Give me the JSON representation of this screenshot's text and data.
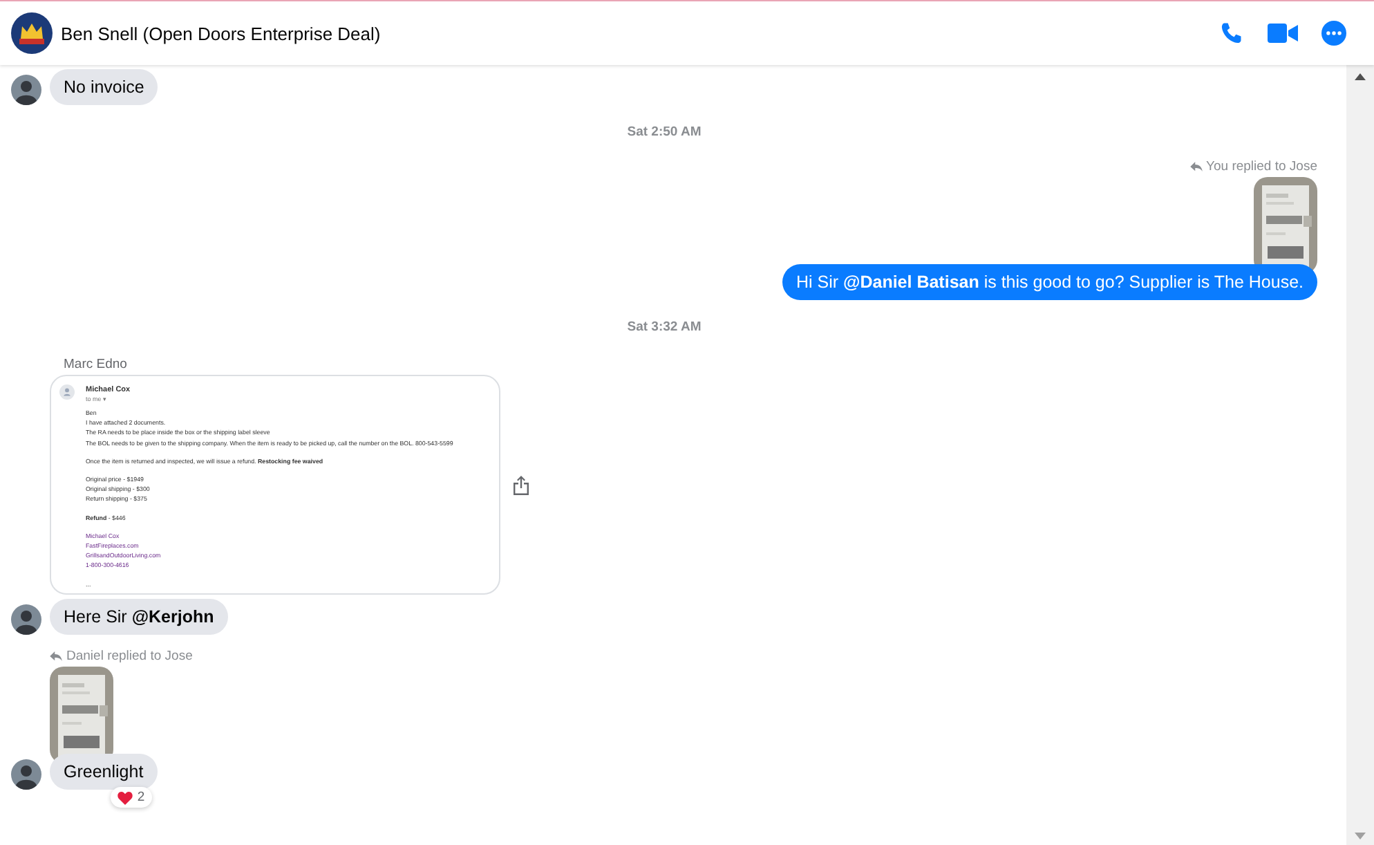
{
  "header": {
    "title": "Ben Snell (Open Doors Enterprise Deal)",
    "actions": [
      {
        "kind": "call"
      },
      {
        "kind": "video"
      },
      {
        "kind": "more"
      }
    ]
  },
  "messages": [
    {
      "kind": "text_in",
      "text": "No invoice",
      "avatar": true
    },
    {
      "kind": "time",
      "text": "Sat 2:50 AM"
    },
    {
      "kind": "reply_out",
      "text": "You replied to Jose"
    },
    {
      "kind": "image_out"
    },
    {
      "kind": "text_out",
      "text": "Hi Sir **@Daniel Batisan** is this good to go? Supplier is The House."
    },
    {
      "kind": "time",
      "text": "Sat 3:32 AM"
    },
    {
      "kind": "sender",
      "text": "Marc Edno"
    },
    {
      "kind": "email",
      "share": true,
      "from": "Michael Cox",
      "to": "to me ▾",
      "paragraphs": [
        {
          "kind": "plain",
          "lines": [
            "Ben",
            "I have attached 2 documents.",
            "The RA needs to be place inside the box or the shipping label sleeve",
            "The BOL needs to be given to the shipping company.  When the item is ready to be picked up, call the number on the BOL. 800-543-5599"
          ]
        },
        {
          "kind": "plain",
          "lines": [
            "Once the item is returned and inspected, we will issue a refund. **Restocking fee waived**"
          ]
        },
        {
          "kind": "plain",
          "lines": [
            "Original price - $1949",
            "Original shipping - $300",
            "Return shipping - $375"
          ]
        },
        {
          "kind": "plain",
          "lines": [
            "**Refund** - $446"
          ]
        },
        {
          "kind": "link",
          "lines": [
            "Michael Cox",
            "FastFireplaces.com",
            "GrillsandOutdoorLiving.com",
            "1-800-300-4616"
          ]
        },
        {
          "kind": "plain",
          "lines": [
            "..."
          ]
        }
      ]
    },
    {
      "kind": "text_in",
      "text": "Here Sir **@Kerjohn**",
      "avatar": true
    },
    {
      "kind": "reply_in",
      "text": "Daniel replied to Jose"
    },
    {
      "kind": "image_in"
    },
    {
      "kind": "text_in",
      "text": "Greenlight",
      "avatar": true,
      "reaction": {
        "count": "2"
      }
    }
  ]
}
